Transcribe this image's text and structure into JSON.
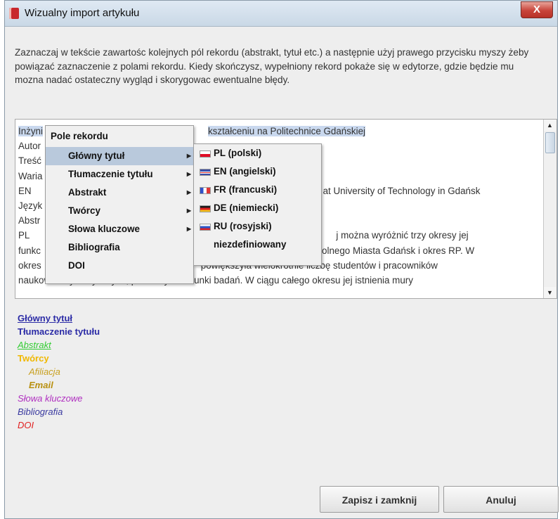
{
  "window": {
    "title": "Wizualny import artykułu",
    "close_label": "X"
  },
  "instructions": "Zaznaczaj w tekście zawartośc kolejnych pól rekordu (abstrakt, tytuł etc.) a następnie użyj prawego przycisku myszy żeby powiązać zaznaczenie z polami rekordu. Kiedy skończysz, wypełniony rekord pokaże się w edytorze, gdzie będzie mu mozna nadać ostateczny wygląd i skorygowac ewentualne błędy.",
  "text_area": {
    "lines": [
      {
        "left": "Inżyni",
        "right": "kształceniu na Politechnice Gdańskiej"
      },
      {
        "left": "Autor",
        "right": ""
      },
      {
        "left": "Treść",
        "right": ""
      },
      {
        "left": "Waria",
        "right": ""
      },
      {
        "left": "EN",
        "right": "at University of Technology in Gdańsk"
      },
      {
        "left": "Język",
        "right": ""
      },
      {
        "left": "Abstr",
        "right": ""
      },
      {
        "left": "PL",
        "right": "j można wyróżnić trzy okresy jej"
      },
      {
        "left": "funkc",
        "right": "olnego Miasta Gdańsk i okres RP. W"
      },
      {
        "left": "okres",
        "right": "powiększyła wielokrotnie liczbę studentów i pracowników"
      },
      {
        "left": "naukowo - dydaktycznych, poszerzyła kierunki badań. W ciągu całego okresu jej istnienia mury",
        "right": ""
      }
    ]
  },
  "context_menu": {
    "header": "Pole rekordu",
    "items": [
      {
        "label": "Główny tytuł",
        "submenu": true
      },
      {
        "label": "Tłumaczenie tytułu",
        "submenu": true
      },
      {
        "label": "Abstrakt",
        "submenu": true
      },
      {
        "label": "Twórcy",
        "submenu": true
      },
      {
        "label": "Słowa kluczowe",
        "submenu": true
      },
      {
        "label": "Bibliografia",
        "submenu": false
      },
      {
        "label": "DOI",
        "submenu": false
      }
    ],
    "submenu": [
      {
        "label": "PL (polski)",
        "flag": "flag-pl-icon"
      },
      {
        "label": "EN (angielski)",
        "flag": "flag-en-icon"
      },
      {
        "label": "FR (francuski)",
        "flag": "flag-fr-icon"
      },
      {
        "label": "DE (niemiecki)",
        "flag": "flag-de-icon"
      },
      {
        "label": "RU (rosyjski)",
        "flag": "flag-ru-icon"
      },
      {
        "label": "niezdefiniowany",
        "flag": ""
      }
    ]
  },
  "legend": {
    "title": "Główny tytuł",
    "translation": "Tłumaczenie tytułu",
    "abstract": "Abstrakt",
    "creators": "Twórcy",
    "affiliation": "Afiliacja",
    "email": "Email",
    "keywords": "Słowa kluczowe",
    "bibliography": "Bibliografia",
    "doi": "DOI"
  },
  "buttons": {
    "save": "Zapisz i zamknij",
    "cancel": "Anuluj"
  },
  "colors": {
    "title": "#2b2ba6",
    "abstract": "#33cc33",
    "creators": "#f0b800",
    "keywords": "#b030c0",
    "doi": "#e02020",
    "close": "#c8443a"
  }
}
